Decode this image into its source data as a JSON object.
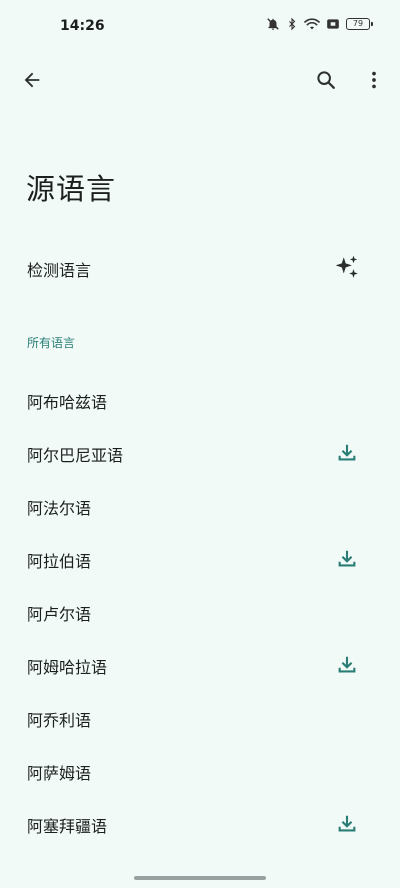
{
  "status_bar": {
    "time": "14:26",
    "battery_level": "79",
    "icons": [
      "notifications-off-icon",
      "bluetooth-icon",
      "wifi-icon",
      "data-saver-icon",
      "battery-icon"
    ]
  },
  "app_bar": {
    "icons": [
      "back-arrow-icon",
      "search-icon",
      "more-vert-icon"
    ]
  },
  "title": "源语言",
  "detect": {
    "label": "检测语言",
    "icon": "sparkle-icon"
  },
  "section_header": "所有语言",
  "languages": [
    {
      "label": "阿布哈兹语",
      "downloadable": false
    },
    {
      "label": "阿尔巴尼亚语",
      "downloadable": true
    },
    {
      "label": "阿法尔语",
      "downloadable": false
    },
    {
      "label": "阿拉伯语",
      "downloadable": true
    },
    {
      "label": "阿卢尔语",
      "downloadable": false
    },
    {
      "label": "阿姆哈拉语",
      "downloadable": true
    },
    {
      "label": "阿乔利语",
      "downloadable": false
    },
    {
      "label": "阿萨姆语",
      "downloadable": false
    },
    {
      "label": "阿塞拜疆语",
      "downloadable": true
    }
  ],
  "colors": {
    "background": "#f2faf8",
    "accent": "#2a7d74",
    "text": "#1b1f1e"
  }
}
